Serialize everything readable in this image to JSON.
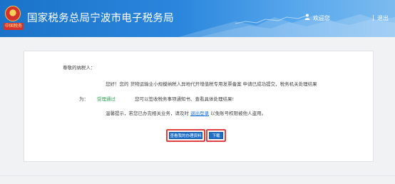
{
  "header": {
    "title": "国家税务总局宁波市电子税务局",
    "emblem_text": "中国税务",
    "user_name": "欢迎您",
    "logout": "退出"
  },
  "notice": {
    "greeting": "尊敬的纳税人：",
    "line1": "您好！您的 货物运输业小规模纳税人异地代开增值税专用发票备案 申请已成功提交，税务机关处理结果",
    "for_label": "为：",
    "status": "受理通过",
    "line2": "您可以签收税务事项通知书、查看具体处理结果!",
    "tip_prefix": "温馨提示，若您已办完相关业务，请及时",
    "tip_link": "退出登录",
    "tip_suffix": "以免账号权限被他人盗用。"
  },
  "buttons": {
    "view": "查看我的办理资料",
    "download": "下载"
  },
  "colors": {
    "header_blue": "#1a73c9",
    "button_blue": "#1e6fc8",
    "status_green": "#2ea44f",
    "highlight_red": "#e0403f",
    "link_blue": "#1a6fd8"
  }
}
